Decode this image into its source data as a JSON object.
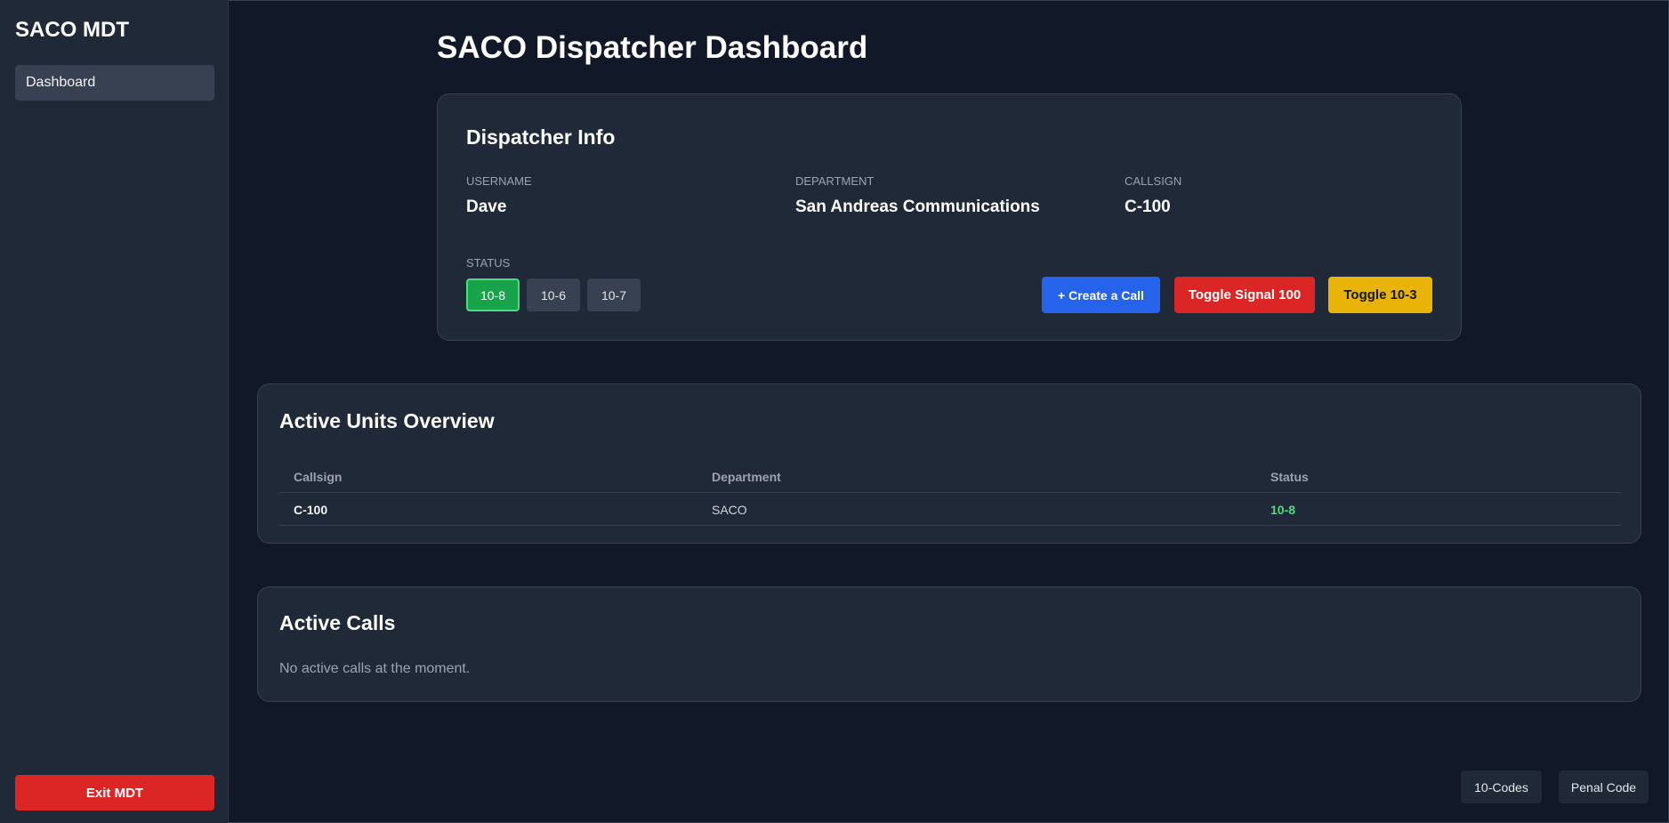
{
  "sidebar": {
    "brand": "SACO MDT",
    "nav_items": [
      {
        "label": "Dashboard"
      }
    ],
    "exit_label": "Exit MDT"
  },
  "page": {
    "title": "SACO Dispatcher Dashboard"
  },
  "dispatcher_info": {
    "title": "Dispatcher Info",
    "fields": [
      {
        "label": "USERNAME",
        "value": "Dave"
      },
      {
        "label": "DEPARTMENT",
        "value": "San Andreas Communications"
      },
      {
        "label": "CALLSIGN",
        "value": "C-100"
      }
    ],
    "status_label": "STATUS",
    "status_options": [
      "10-8",
      "10-6",
      "10-7"
    ],
    "active_status": "10-8",
    "actions": {
      "create_call": "+ Create a Call",
      "toggle_signal": "Toggle Signal 100",
      "toggle_103": "Toggle 10-3"
    }
  },
  "active_units": {
    "title": "Active Units Overview",
    "columns": [
      "Callsign",
      "Department",
      "Status"
    ],
    "rows": [
      {
        "callsign": "C-100",
        "department": "SACO",
        "status": "10-8"
      }
    ]
  },
  "active_calls": {
    "title": "Active Calls",
    "empty_message": "No active calls at the moment."
  },
  "footer": {
    "codes_label": "10-Codes",
    "penal_label": "Penal Code"
  },
  "colors": {
    "background": "#111827",
    "panel": "#1f2937",
    "accent_blue": "#2563eb",
    "accent_red": "#dc2626",
    "accent_yellow": "#eab308",
    "status_green": "#16a34a"
  }
}
